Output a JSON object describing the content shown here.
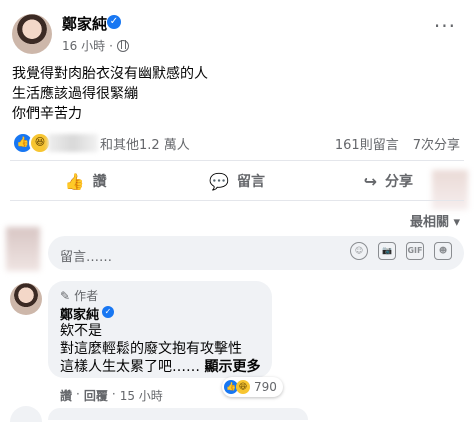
{
  "post": {
    "author": "鄭家純",
    "time": "16 小時",
    "privacy_separator": "·",
    "more": "···",
    "text_lines": [
      "我覺得對肉胎衣沒有幽默感的人",
      "生活應該過得很緊繃",
      "你們辛苦力"
    ],
    "reactions": {
      "like_icon": "👍",
      "haha_icon": "😆",
      "summary": "和其他1.2 萬人",
      "comments": "161則留言",
      "shares": "7次分享"
    },
    "actions": {
      "like": "讚",
      "comment": "留言",
      "share": "分享"
    },
    "sort": "最相關 ▾"
  },
  "composer": {
    "placeholder": "留言……",
    "tools": [
      "☺",
      "📷",
      "GIF",
      "☻"
    ]
  },
  "comment": {
    "role": "作者",
    "author": "鄭家純",
    "lines": [
      "欸不是",
      "對這麼輕鬆的廢文抱有攻擊性",
      "這樣人生太累了吧……"
    ],
    "show_more": "顯示更多",
    "reaction_count": "790",
    "meta": {
      "like": "讚",
      "reply": "回覆",
      "time": "15 小時",
      "dot": "·"
    }
  },
  "colors": {
    "accent": "#1877f2",
    "secondary_text": "#65676b",
    "bubble": "#f0f2f5"
  }
}
